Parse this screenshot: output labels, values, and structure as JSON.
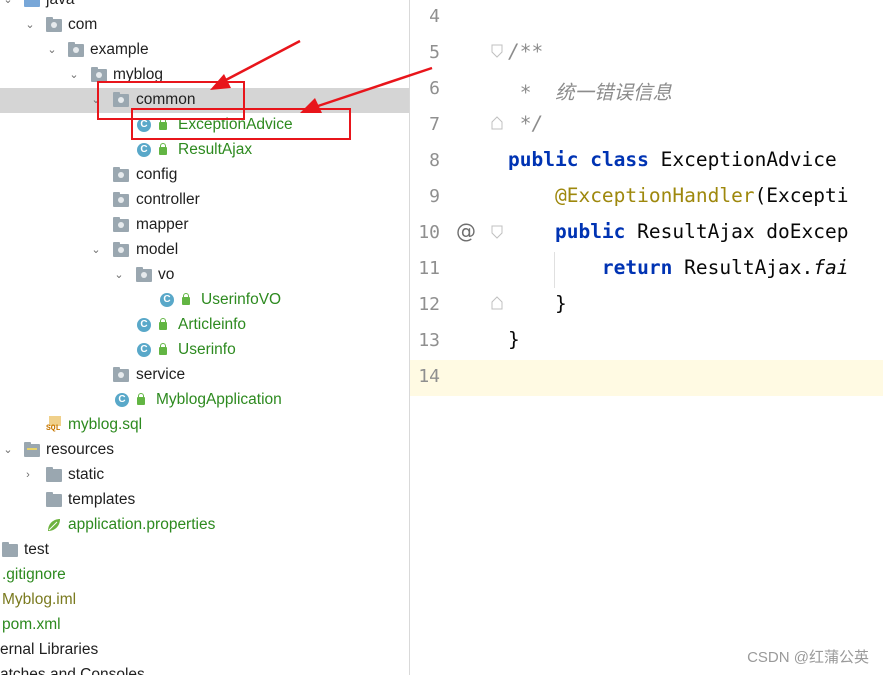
{
  "tree": {
    "items": [
      {
        "label": "java"
      },
      {
        "label": "com"
      },
      {
        "label": "example"
      },
      {
        "label": "myblog"
      },
      {
        "label": "common"
      },
      {
        "label": "ExceptionAdvice"
      },
      {
        "label": "ResultAjax"
      },
      {
        "label": "config"
      },
      {
        "label": "controller"
      },
      {
        "label": "mapper"
      },
      {
        "label": "model"
      },
      {
        "label": "vo"
      },
      {
        "label": "UserinfoVO"
      },
      {
        "label": "Articleinfo"
      },
      {
        "label": "Userinfo"
      },
      {
        "label": "service"
      },
      {
        "label": "MyblogApplication"
      },
      {
        "label": "myblog.sql"
      },
      {
        "label": "resources"
      },
      {
        "label": "static"
      },
      {
        "label": "templates"
      },
      {
        "label": "application.properties"
      },
      {
        "label": "test"
      },
      {
        "label": ".gitignore"
      },
      {
        "label": "Myblog.iml"
      },
      {
        "label": "pom.xml"
      },
      {
        "label": "ernal Libraries"
      },
      {
        "label": "atches and Consoles"
      }
    ],
    "class_icon_letter": "C",
    "sql_badge": "SQL"
  },
  "editor": {
    "line_numbers": [
      "4",
      "5",
      "6",
      "7",
      "8",
      "9",
      "10",
      "11",
      "12",
      "13",
      "14"
    ],
    "override_marker": "@",
    "lines": {
      "l5": "/**",
      "l6": " *  统一错误信息",
      "l7": " */",
      "l8_kw1": "public",
      "l8_kw2": "class",
      "l8_name": "ExceptionAdvice",
      "l9_ann": "@ExceptionHandler",
      "l9_rest": "(Excepti",
      "l10_kw": "public",
      "l10_rest": "ResultAjax doExcep",
      "l11_kw": "return",
      "l11_cls": "ResultAjax.",
      "l11_method": "fai",
      "l12": "}",
      "l13": "}"
    }
  },
  "watermark": "CSDN @红蒲公英",
  "colors": {
    "keyword": "#0033b3",
    "annotation": "#9e880d",
    "comment": "#8c8c8c",
    "green_file": "#2d8a1f",
    "highlight_red": "#e8151b",
    "selected_row": "#d5d5d5"
  }
}
